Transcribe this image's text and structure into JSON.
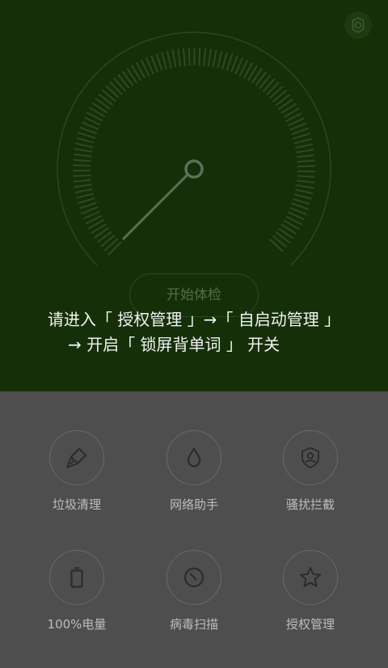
{
  "main_panel": {
    "start_button": "开始体检",
    "instruction_line1": "请进入「 授权管理 」→「 自启动管理 」",
    "instruction_line2": "→ 开启「 锁屏背单词 」 开关"
  },
  "grid": [
    {
      "label": "垃圾清理",
      "icon": "broom-icon"
    },
    {
      "label": "网络助手",
      "icon": "drop-icon"
    },
    {
      "label": "骚扰拦截",
      "icon": "shield-person-icon"
    },
    {
      "label": "100%电量",
      "icon": "battery-icon"
    },
    {
      "label": "病毒扫描",
      "icon": "scan-icon"
    },
    {
      "label": "授权管理",
      "icon": "star-icon"
    }
  ],
  "colors": {
    "top_panel": "#153009",
    "bottom_panel": "#4e4e4e",
    "instruction_text": "#f2f2f2"
  }
}
